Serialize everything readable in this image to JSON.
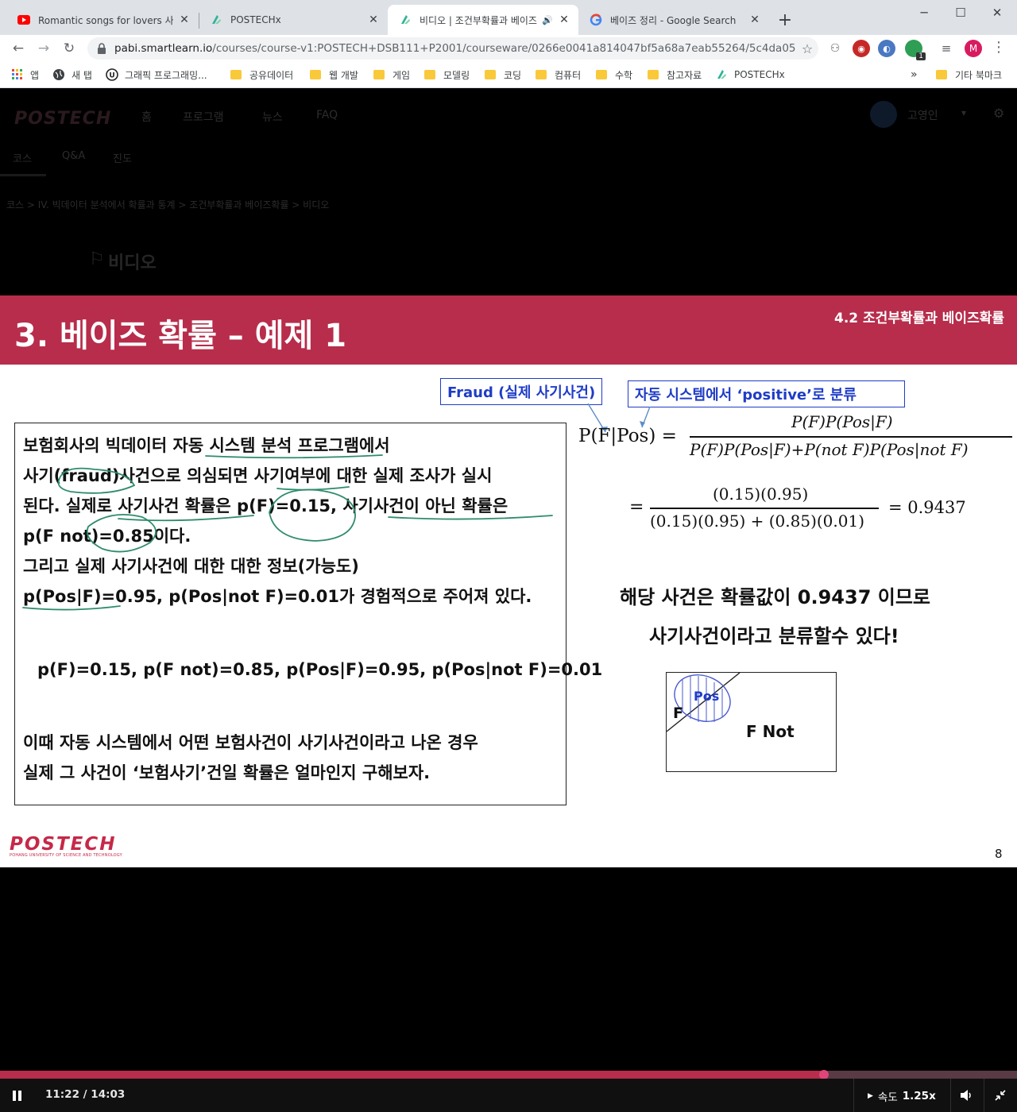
{
  "browser": {
    "tabs": [
      {
        "title": "Romantic songs for lovers 사랑하",
        "favicon": "youtube-icon"
      },
      {
        "title": "POSTECHx",
        "favicon": "smartlearn-icon"
      },
      {
        "title": "비디오 | 조건부확률과 베이즈",
        "favicon": "smartlearn-icon",
        "active": true
      },
      {
        "title": "베이즈 정리 - Google Search",
        "favicon": "google-icon"
      }
    ],
    "url_host": "pabi.smartlearn.io",
    "url_path": "/courses/course-v1:POSTECH+DSB111+P2001/courseware/0266e0041a814047bf5a68a7eab55264/5c4da05d33d24cc...",
    "extension_badge": "1",
    "profile_initial": "M",
    "bookmarks": [
      {
        "label": "앱",
        "icon": "apps-grid-icon"
      },
      {
        "label": "새 탭",
        "icon": "globe-icon"
      },
      {
        "label": "그래픽 프로그래밍...",
        "icon": "unreal-icon"
      },
      {
        "label": "공유데이터",
        "icon": "folder-icon"
      },
      {
        "label": "웹 개발",
        "icon": "folder-icon"
      },
      {
        "label": "게임",
        "icon": "folder-icon"
      },
      {
        "label": "모델링",
        "icon": "folder-icon"
      },
      {
        "label": "코딩",
        "icon": "folder-icon"
      },
      {
        "label": "컴퓨터",
        "icon": "folder-icon"
      },
      {
        "label": "수학",
        "icon": "folder-icon"
      },
      {
        "label": "참고자료",
        "icon": "folder-icon"
      },
      {
        "label": "POSTECHx",
        "icon": "smartlearn-icon"
      }
    ],
    "bookmarks_overflow": "»",
    "other_bookmarks": "기타 북마크"
  },
  "site": {
    "logo": "POSTECH",
    "nav": [
      "홈",
      "프로그램",
      "뉴스",
      "FAQ"
    ],
    "user": "고영인",
    "course_tabs": [
      "코스",
      "Q&A",
      "진도"
    ],
    "breadcrumb": "코스 > IV. 빅데이터 분석에서 확률과 통계 > 조건부확률과 베이즈확률 > 비디오",
    "page_heading": "비디오"
  },
  "slide": {
    "title": "3. 베이즈 확률 – 예제 1",
    "section": "4.2 조건부확률과 베이즈확률",
    "label_fraud": "Fraud (실제 사기사건)",
    "label_positive": "자동 시스템에서 ‘positive’로 분류",
    "problem_lines": [
      "보험회사의 빅데이터 자동 시스템 분석 프로그램에서",
      "사기(fraud)사건으로 의심되면 사기여부에 대한 실제 조사가 실시",
      "된다. 실제로 사기사건 확률은 p(F)=0.15, 사기사건이 아닌 확률은",
      "p(F not)=0.85이다.",
      "그리고 실제 사기사건에 대한 대한 정보(가능도)",
      "p(Pos|F)=0.95, p(Pos|not F)=0.01가 경험적으로 주어져 있다.",
      "p(F)=0.15, p(F not)=0.85, p(Pos|F)=0.95, p(Pos|not F)=0.01",
      "이때 자동 시스템에서 어떤 보험사건이 사기사건이라고 나온 경우",
      "실제 그 사건이 ‘보험사기’건일 확률은 얼마인지 구해보자."
    ],
    "formula": {
      "lhs": "P(F|Pos) =",
      "numerator": "P(F)P(Pos|F)",
      "denominator": "P(F)P(Pos|F)+P(not F)P(Pos|not F)",
      "eq2": "=",
      "numerator2": "(0.15)(0.95)",
      "denominator2": "(0.15)(0.95) + (0.85)(0.01)",
      "result": "= 0.9437"
    },
    "conclusion_lines": [
      "해당 사건은 확률값이 0.9437 이므로",
      "사기사건이라고 분류할수 있다!"
    ],
    "venn": {
      "pos": "Pos",
      "f": "F",
      "fnot": "F Not"
    },
    "footer_logo": "POSTECH",
    "footer_logo_sub": "POHANG UNIVERSITY OF SCIENCE AND TECHNOLOGY",
    "page_number": "8"
  },
  "player": {
    "time": "11:22 / 14:03",
    "progress": 0.81,
    "speed_label": "속도",
    "speed_value": "1.25x"
  },
  "colors": {
    "accent": "#b72d4b",
    "label_blue": "#1f3cc7",
    "annotation_green": "#2e8b6e"
  }
}
